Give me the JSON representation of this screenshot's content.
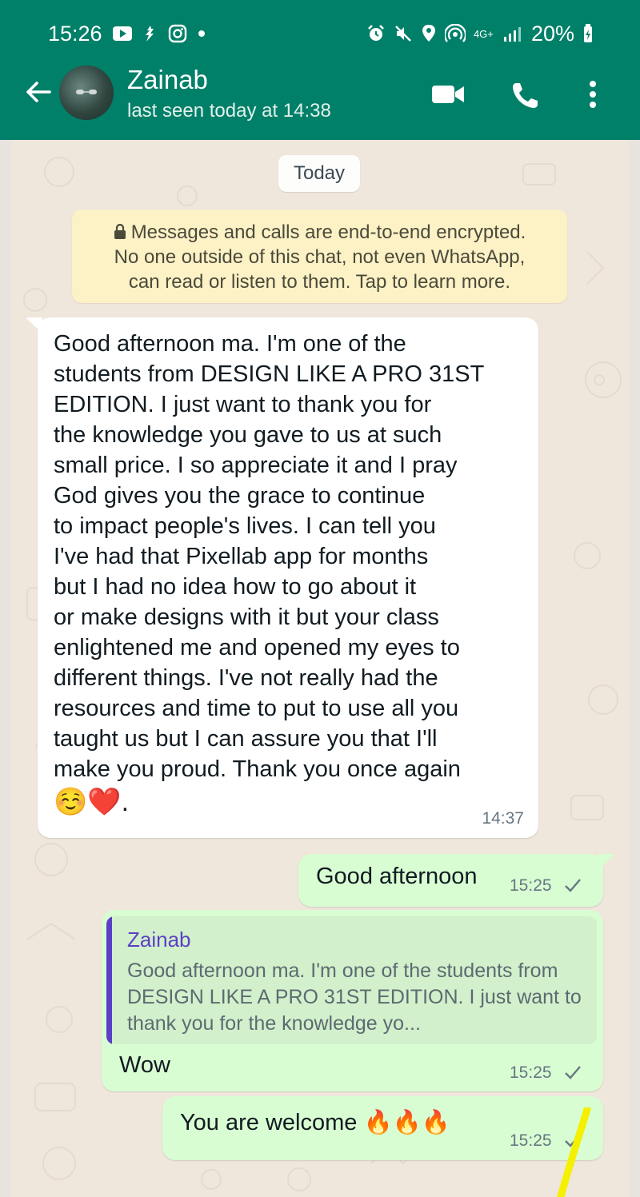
{
  "status_bar": {
    "time": "15:26",
    "battery": "20%",
    "network": "4G+"
  },
  "header": {
    "contact_name": "Zainab",
    "last_seen": "last seen today at 14:38"
  },
  "chat": {
    "date_chip": "Today",
    "encryption_notice": {
      "line1": "Messages and calls are end-to-end encrypted.",
      "line2": "No one outside of this chat, not even WhatsApp,",
      "line3": "can read or listen to them. Tap to learn more."
    },
    "messages": [
      {
        "direction": "incoming",
        "text": "Good afternoon ma. I'm one of the\nstudents from DESIGN LIKE A PRO 31ST\nEDITION. I just want to thank you for\nthe knowledge you gave to us at such\nsmall price. I so appreciate it and I pray\nGod gives you the grace to continue\nto impact people's lives. I can tell you\nI've had that Pixellab app for months\nbut I had no idea how to go about it\nor make designs with it but your class\nenlightened me and opened my eyes to\ndifferent things. I've not really had the\nresources and time to put to use all you\ntaught us but I can assure you that I'll\nmake you proud. Thank you once again",
        "emoji": "☺️❤️.",
        "time": "14:37"
      },
      {
        "direction": "outgoing",
        "text": "Good afternoon",
        "time": "15:25"
      },
      {
        "direction": "outgoing",
        "quoted_name": "Zainab",
        "quoted_text": "Good afternoon ma. I'm one of the students from DESIGN LIKE A PRO 31ST EDITION. I just want to thank you for the knowledge yo...",
        "text": "Wow",
        "time": "15:25"
      },
      {
        "direction": "outgoing",
        "text": "You are welcome 🔥🔥🔥",
        "time": "15:25"
      }
    ]
  },
  "colors": {
    "header": "#008069",
    "outgoing_bubble": "#d9fdd3",
    "incoming_bubble": "#ffffff",
    "quote_accent": "#5b3fc6",
    "encryption_notice": "#fdf1c6"
  }
}
